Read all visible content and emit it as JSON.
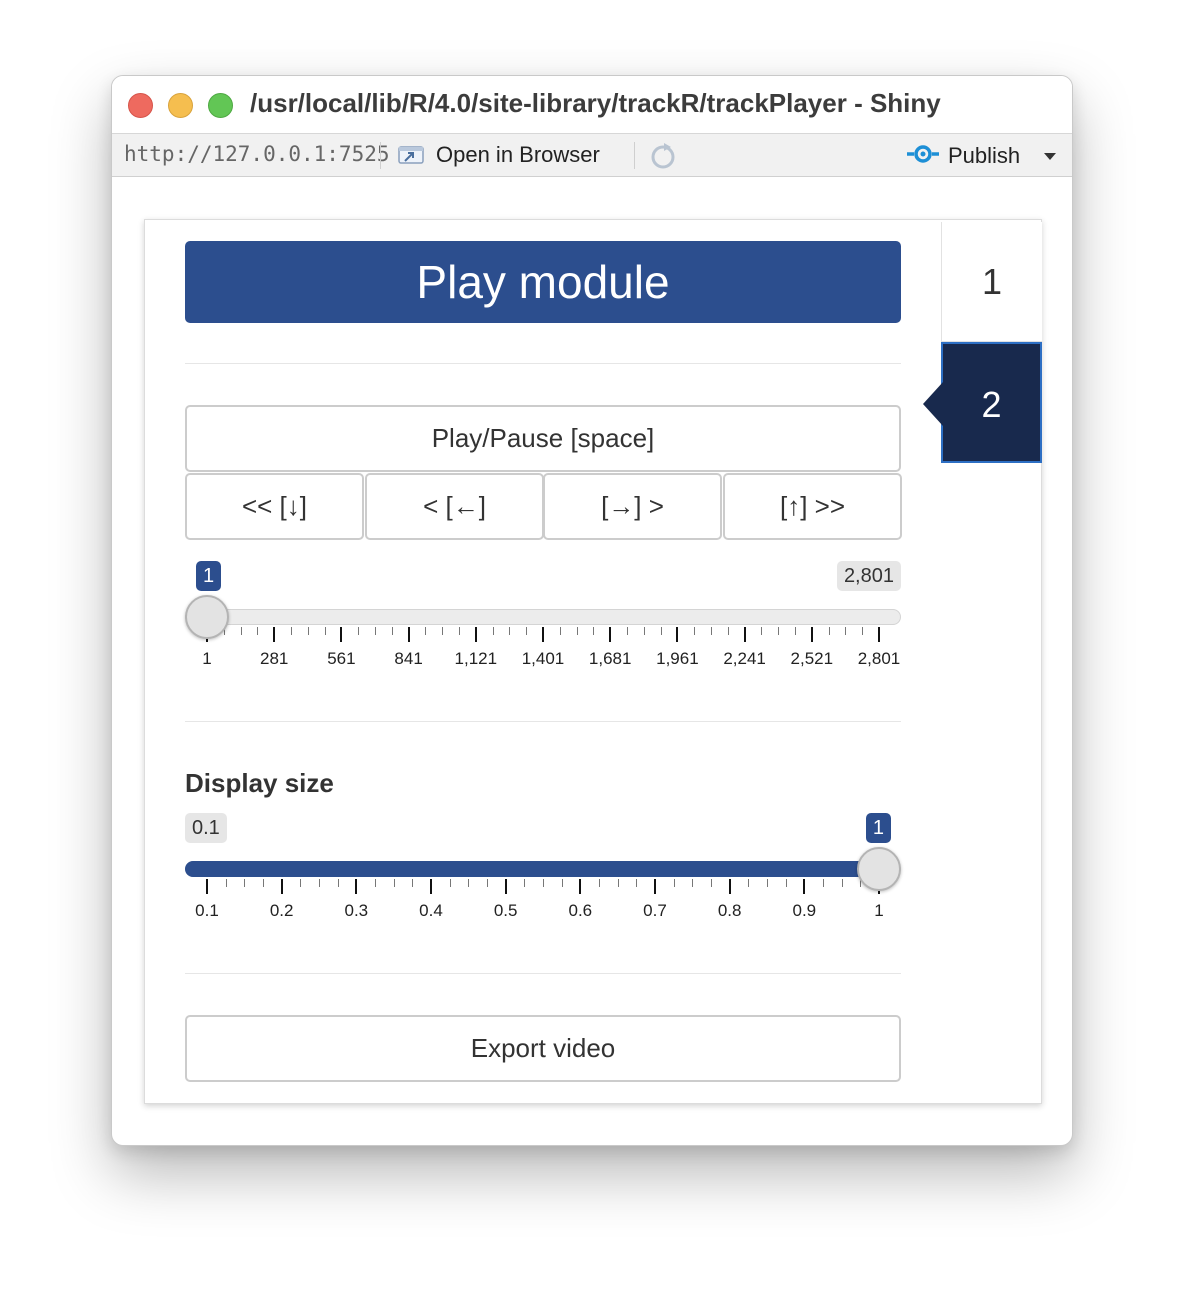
{
  "window": {
    "title": "/usr/local/lib/R/4.0/site-library/trackR/trackPlayer - Shiny"
  },
  "toolbar": {
    "url": "http://127.0.0.1:7525",
    "open_in_browser": "Open in Browser",
    "publish": "Publish",
    "icons": [
      "open-in-browser-icon",
      "refresh-icon",
      "publish-icon",
      "chevron-down-icon"
    ]
  },
  "colors": {
    "primary": "#2c4e8e",
    "active_tab": "#18294d",
    "active_tab_border": "#2d6fc4"
  },
  "tabs": [
    {
      "label": "1",
      "active": false
    },
    {
      "label": "2",
      "active": true
    }
  ],
  "play_module": {
    "title": "Play module",
    "play_pause_label": "Play/Pause [space]",
    "step_buttons": [
      "<< [↓]",
      "< [←]",
      "[→] >",
      "[↑] >>"
    ]
  },
  "frame_slider": {
    "min_label": "1",
    "max_label": "2,801",
    "value_label": "1",
    "value": 1,
    "min": 1,
    "max": 2801,
    "tick_labels": [
      "1",
      "281",
      "561",
      "841",
      "1,121",
      "1,401",
      "1,681",
      "1,961",
      "2,241",
      "2,521",
      "2,801"
    ]
  },
  "display_size": {
    "label": "Display size",
    "min_label": "0.1",
    "value_label": "1",
    "value": 1,
    "min": 0.1,
    "max": 1,
    "tick_labels": [
      "0.1",
      "0.2",
      "0.3",
      "0.4",
      "0.5",
      "0.6",
      "0.7",
      "0.8",
      "0.9",
      "1"
    ]
  },
  "export": {
    "label": "Export video"
  }
}
